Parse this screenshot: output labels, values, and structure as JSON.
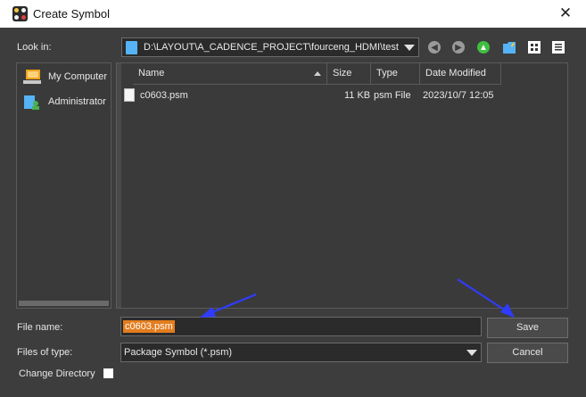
{
  "window": {
    "title": "Create Symbol",
    "close_glyph": "✕"
  },
  "lookin": {
    "label": "Look in:",
    "path": "D:\\LAYOUT\\A_CADENCE_PROJECT\\fourceng_HDMI\\test"
  },
  "toolbar": {
    "icons": [
      "back-icon",
      "forward-icon",
      "up-folder-icon",
      "new-folder-icon",
      "list-view-icon",
      "detail-view-icon"
    ],
    "colors": {
      "nav_gray": "#9a9a9a",
      "up_green": "#3fbf3f",
      "folder_blue": "#56b3f5"
    }
  },
  "sidebar": {
    "items": [
      {
        "label": "My Computer",
        "icon": "computer-icon"
      },
      {
        "label": "Administrator",
        "icon": "user-folder-icon"
      }
    ]
  },
  "filelist": {
    "columns": [
      "Name",
      "Size",
      "Type",
      "Date Modified"
    ],
    "rows": [
      {
        "name": "c0603.psm",
        "size": "11 KB",
        "type": "psm File",
        "date": "2023/10/7 12:05"
      }
    ]
  },
  "form": {
    "filename_label": "File name:",
    "filename_value": "c0603.psm",
    "filetype_label": "Files of type:",
    "filetype_value": "Package Symbol (*.psm)",
    "change_dir_label": "Change Directory",
    "change_dir_checked": false
  },
  "buttons": {
    "save": "Save",
    "cancel": "Cancel"
  },
  "colors": {
    "background": "#3d3d3d",
    "selection": "#e37d1e",
    "annotation_arrow": "#2f3cff"
  }
}
